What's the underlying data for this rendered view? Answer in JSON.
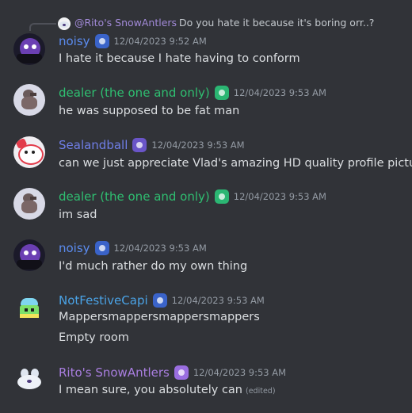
{
  "reply": {
    "name": "@Rito's SnowAntlers",
    "text": "Do you hate it because it's boring orr..?"
  },
  "messages": [
    {
      "name": "noisy",
      "name_color": "#5b8cf0",
      "badge": "blue-badge",
      "timestamp": "12/04/2023 9:52 AM",
      "lines": [
        "I hate it because I hate having to conform"
      ]
    },
    {
      "name": "dealer (the one and only)",
      "name_color": "#2fbf71",
      "badge": "green-badge",
      "timestamp": "12/04/2023 9:53 AM",
      "lines": [
        "he was supposed to be fat man"
      ]
    },
    {
      "name": "Sealandball",
      "name_color": "#6f7ee6",
      "badge": "purple-badge",
      "timestamp": "12/04/2023 9:53 AM",
      "lines": [
        "can we just appreciate Vlad's amazing HD quality profile picture"
      ]
    },
    {
      "name": "dealer (the one and only)",
      "name_color": "#2fbf71",
      "badge": "green-badge",
      "timestamp": "12/04/2023 9:53 AM",
      "lines": [
        "im sad"
      ]
    },
    {
      "name": "noisy",
      "name_color": "#5b8cf0",
      "badge": "blue-badge",
      "timestamp": "12/04/2023 9:53 AM",
      "lines": [
        "I'd much rather do my own thing"
      ]
    },
    {
      "name": "NotFestiveCapi",
      "name_color": "#4aa3e6",
      "badge": "blue-badge",
      "timestamp": "12/04/2023 9:53 AM",
      "lines": [
        "Mappersmappersmappersmappers",
        "Empty room"
      ]
    },
    {
      "name": "Rito's SnowAntlers",
      "name_color": "#a97ee0",
      "badge": "lavender-badge",
      "timestamp": "12/04/2023 9:53 AM",
      "lines": [
        "I mean sure, you absolutely can"
      ],
      "edited": "(edited)"
    }
  ]
}
